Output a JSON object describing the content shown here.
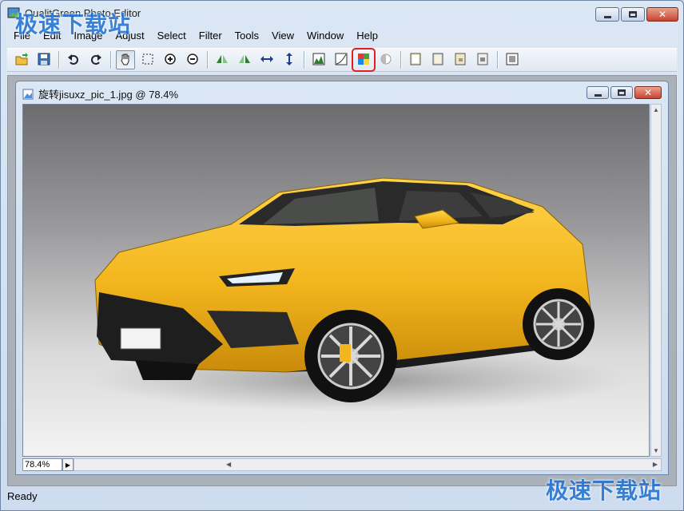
{
  "app": {
    "title": "QualitGreen Photo Editor"
  },
  "watermark": {
    "text": "极速下载站"
  },
  "menu": [
    "File",
    "Edit",
    "Image",
    "Adjust",
    "Select",
    "Filter",
    "Tools",
    "View",
    "Window",
    "Help"
  ],
  "toolbar": [
    {
      "name": "open-icon"
    },
    {
      "name": "save-icon"
    },
    {
      "sep": true
    },
    {
      "name": "undo-icon"
    },
    {
      "name": "redo-icon"
    },
    {
      "sep": true
    },
    {
      "name": "hand-tool-icon",
      "pressed": true
    },
    {
      "name": "marquee-select-icon"
    },
    {
      "name": "zoom-in-icon"
    },
    {
      "name": "zoom-out-icon"
    },
    {
      "sep": true
    },
    {
      "name": "flip-left-icon"
    },
    {
      "name": "flip-right-icon"
    },
    {
      "name": "flip-horizontal-icon"
    },
    {
      "name": "flip-vertical-icon"
    },
    {
      "sep": true
    },
    {
      "name": "levels-icon"
    },
    {
      "name": "curves-icon"
    },
    {
      "name": "color-balance-icon",
      "highlight": true
    },
    {
      "name": "brightness-icon"
    },
    {
      "sep": true
    },
    {
      "name": "frame-1-icon"
    },
    {
      "name": "frame-2-icon"
    },
    {
      "name": "frame-3-icon"
    },
    {
      "name": "frame-4-icon"
    },
    {
      "sep": true
    },
    {
      "name": "fullscreen-icon"
    }
  ],
  "document": {
    "title": "旋转jisuxz_pic_1.jpg @ 78.4%",
    "zoom": "78.4%"
  },
  "status": {
    "text": "Ready"
  },
  "colors": {
    "car": "#f2b51d",
    "highlight": "#e02020"
  }
}
